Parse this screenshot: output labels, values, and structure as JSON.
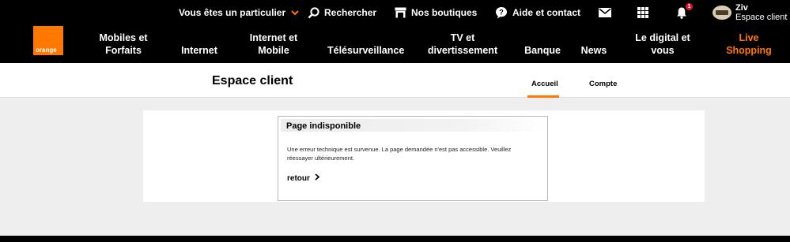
{
  "header": {
    "utility": {
      "particulier_label": "Vous êtes un particulier",
      "search_label": "Rechercher",
      "stores_label": "Nos boutiques",
      "help_label": "Aide et contact",
      "notification_count": "1",
      "account_name": "Ziv",
      "account_sub": "Espace client"
    },
    "logo_text": "orange",
    "nav": [
      {
        "line1": "Mobiles et",
        "line2": "Forfaits"
      },
      {
        "line1": "",
        "line2": "Internet"
      },
      {
        "line1": "Internet et",
        "line2": "Mobile"
      },
      {
        "line1": "",
        "line2": "Télésurveillance"
      },
      {
        "line1": "TV et",
        "line2": "divertissement"
      },
      {
        "line1": "",
        "line2": "Banque"
      },
      {
        "line1": "",
        "line2": "News"
      },
      {
        "line1": "Le digital et",
        "line2": "vous"
      },
      {
        "line1": "Live",
        "line2": "Shopping"
      }
    ]
  },
  "subheader": {
    "title": "Espace client",
    "tabs": [
      {
        "label": "Accueil",
        "active": true
      },
      {
        "label": "Compte",
        "active": false
      }
    ]
  },
  "panel": {
    "title": "Page indisponible",
    "message": "Une erreur technique est survenue. La page demandée n'est pas accessible. Veuillez réessayer ultérieurement.",
    "back_label": "retour"
  },
  "colors": {
    "brand_orange": "#ff7900",
    "header_bg": "#000000",
    "page_bg": "#eeeeee",
    "badge_red": "#e8112d"
  }
}
